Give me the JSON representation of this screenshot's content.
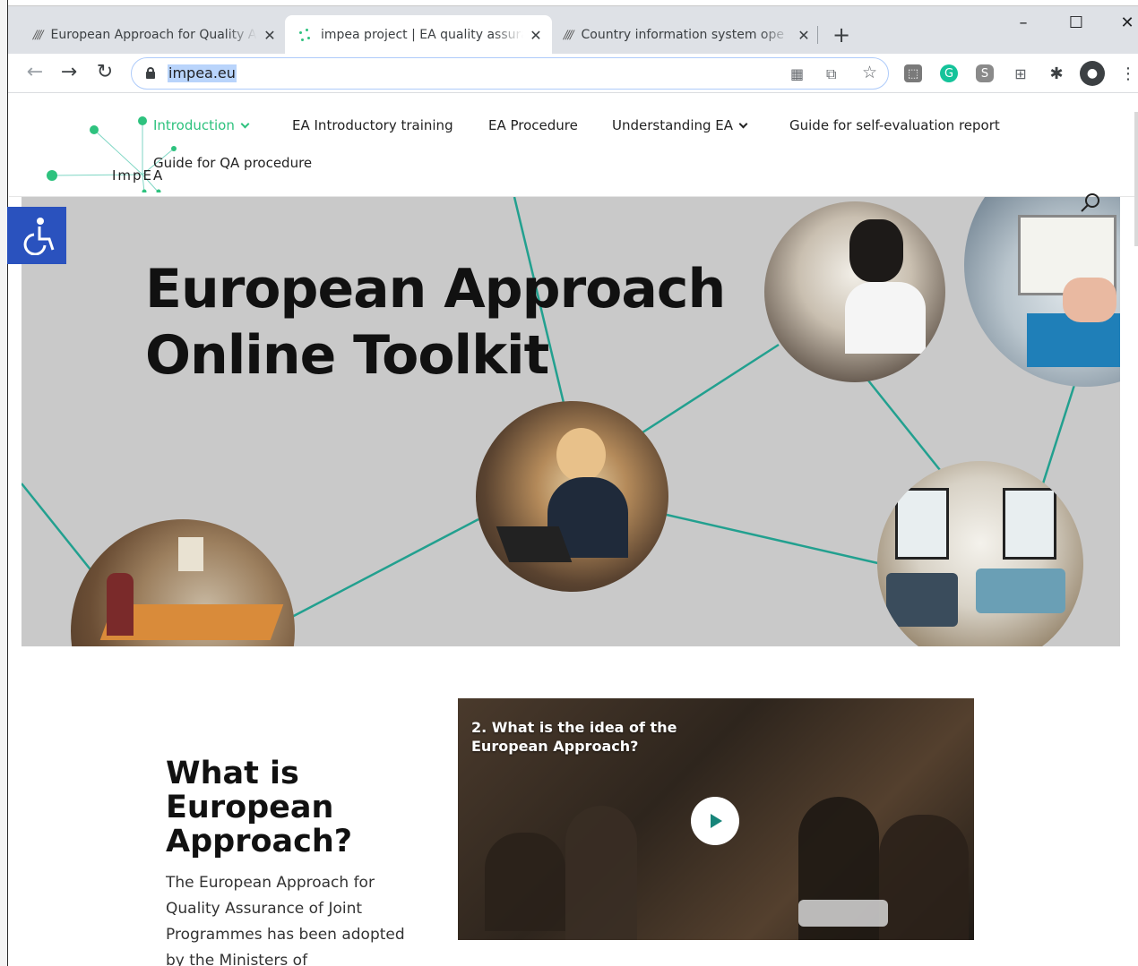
{
  "browser": {
    "tabs": [
      {
        "title": "European Approach for Quality A",
        "favicon": "slashes-favicon",
        "active": false
      },
      {
        "title": "impea project | EA quality assura",
        "favicon": "impea-favicon",
        "active": true
      },
      {
        "title": "Country information system ope",
        "favicon": "slashes-favicon",
        "active": false
      }
    ],
    "url": "impea.eu",
    "new_tab_symbol": "+",
    "window_controls": {
      "minimize": "–",
      "maximize": "☐",
      "close": "✕"
    }
  },
  "site": {
    "logo_text": "ImpEA",
    "nav": [
      {
        "label": "Introduction",
        "active": true,
        "dropdown": true
      },
      {
        "label": "EA Introductory training",
        "active": false,
        "dropdown": false
      },
      {
        "label": "EA Procedure",
        "active": false,
        "dropdown": false
      },
      {
        "label": "Understanding EA",
        "active": false,
        "dropdown": true
      },
      {
        "label": "Guide for self-evaluation report",
        "active": false,
        "dropdown": false
      },
      {
        "label": "Guide for QA procedure",
        "active": false,
        "dropdown": false
      }
    ],
    "accent_color": "#2ec27e",
    "line_color": "#22a08f",
    "a11y_color": "#2a52be"
  },
  "hero": {
    "title_line1": "European Approach",
    "title_line2": "Online Toolkit"
  },
  "intro": {
    "heading_line1": "What is",
    "heading_line2": "European",
    "heading_line3": "Approach?",
    "text": "The European Approach for Quality Assurance of Joint Programmes has been adopted by the Ministers of"
  },
  "video": {
    "title_line1": "2. What is the idea of the",
    "title_line2": "European Approach?"
  }
}
